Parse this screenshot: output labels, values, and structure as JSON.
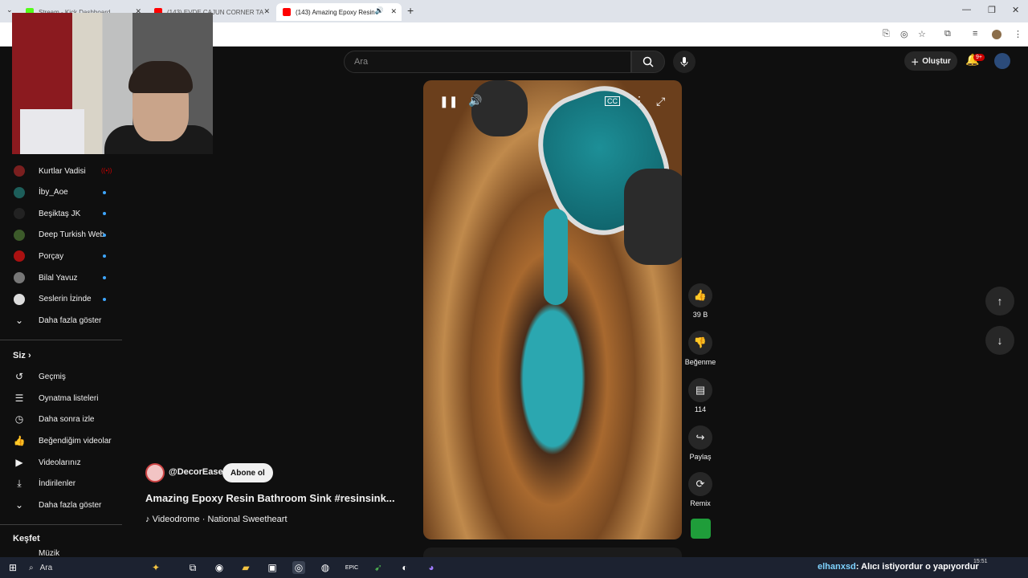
{
  "browser": {
    "tabs": [
      {
        "title": "Stream - Kick Dashboard",
        "color": "#53fc18"
      },
      {
        "title": "(143) EVDE CAJUN CORNER TA",
        "color": "#ff0000"
      },
      {
        "title": "(143) Amazing Epoxy Resin",
        "color": "#ff0000"
      }
    ],
    "new_tab": "+"
  },
  "header": {
    "search_placeholder": "Ara",
    "create_label": "Oluştur",
    "notif_badge": "9+"
  },
  "sidebar": {
    "subscriptions": [
      {
        "name": "Kurtlar Vadisi",
        "color": "#7a1f1f",
        "live": true
      },
      {
        "name": "İby_Aoe",
        "color": "#1d5e5a",
        "live": false
      },
      {
        "name": "Beşiktaş JK",
        "color": "#222",
        "live": false
      },
      {
        "name": "Deep Turkish Web",
        "color": "#3c5a2a",
        "live": false
      },
      {
        "name": "Porçay",
        "color": "#aa1111",
        "live": false
      },
      {
        "name": "Bilal Yavuz",
        "color": "#777",
        "live": false
      },
      {
        "name": "Seslerin İzinde",
        "color": "#ddd",
        "live": false
      }
    ],
    "show_more_1": "Daha fazla göster",
    "you_title": "Siz",
    "you_items": [
      "Geçmiş",
      "Oynatma listeleri",
      "Daha sonra izle",
      "Beğendiğim videolar",
      "Videolarınız",
      "İndirilenler"
    ],
    "show_more_2": "Daha fazla göster",
    "explore_title": "Keşfet",
    "explore_partial": "Müzik"
  },
  "short": {
    "channel": "@DecorEase",
    "subscribe": "Abone ol",
    "title": "Amazing Epoxy Resin Bathroom Sink #resinsink...",
    "sound": "Videodrome · National Sweetheart",
    "likes": "39 B",
    "dislike_label": "Beğenme",
    "comments": "114",
    "share_label": "Paylaş",
    "remix_label": "Remix"
  },
  "taskbar": {
    "search": "Ara",
    "ticker_nick": "elhanxsd",
    "ticker_msg": ": Alıcı istiyordur o yapıyordur",
    "time": "15:51"
  }
}
